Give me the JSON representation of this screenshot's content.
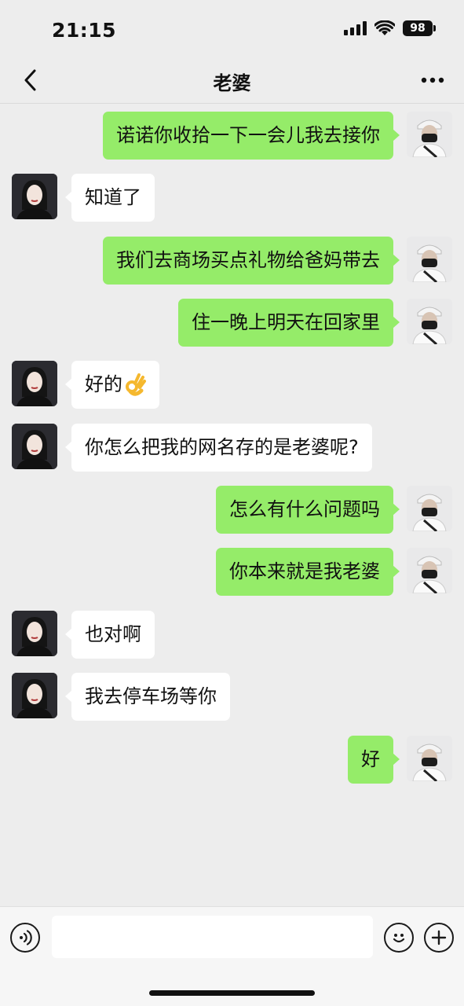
{
  "status_bar": {
    "time": "21:15",
    "battery": "98"
  },
  "header": {
    "title": "老婆"
  },
  "messages": [
    {
      "dir": "out",
      "text": "诺诺你收拾一下一会儿我去接你"
    },
    {
      "dir": "in",
      "text": "知道了"
    },
    {
      "dir": "out",
      "text": "我们去商场买点礼物给爸妈带去"
    },
    {
      "dir": "out",
      "text": "住一晚上明天在回家里"
    },
    {
      "dir": "in",
      "text": "好的",
      "emoji": "ok-hand-emoji"
    },
    {
      "dir": "in",
      "text": "你怎么把我的网名存的是老婆呢?"
    },
    {
      "dir": "out",
      "text": "怎么有什么问题吗"
    },
    {
      "dir": "out",
      "text": "你本来就是我老婆"
    },
    {
      "dir": "in",
      "text": "也对啊"
    },
    {
      "dir": "in",
      "text": "我去停车场等你"
    },
    {
      "dir": "out",
      "text": "好"
    }
  ],
  "input": {
    "value": "",
    "placeholder": ""
  },
  "colors": {
    "sent_bubble": "#95ec69",
    "received_bubble": "#ffffff",
    "background": "#ededed"
  }
}
